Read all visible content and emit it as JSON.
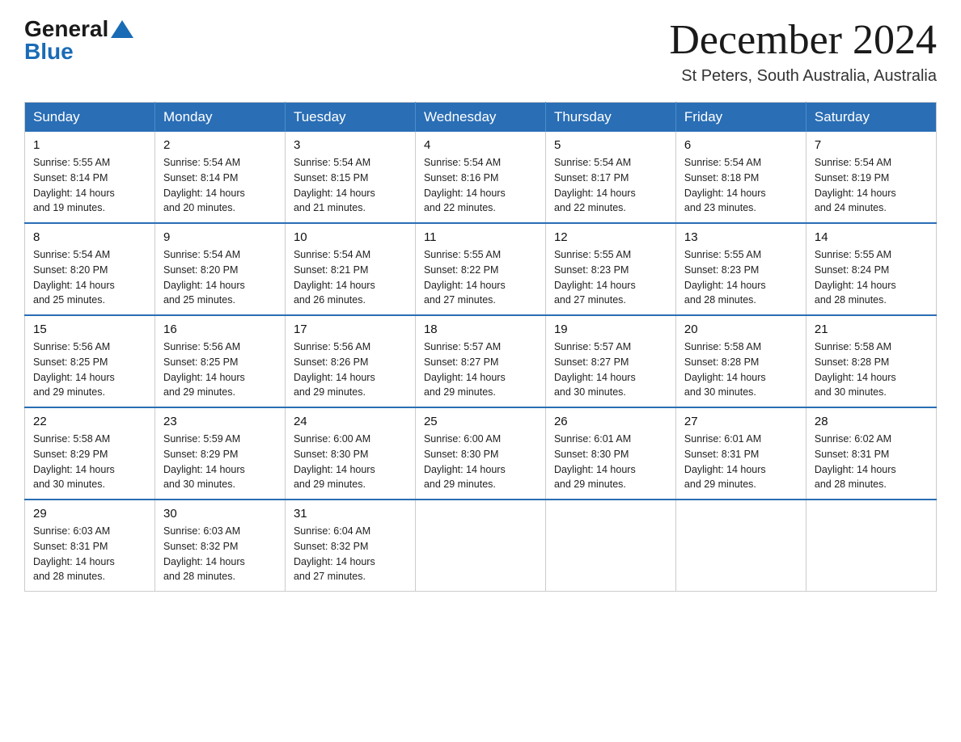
{
  "header": {
    "logo_general": "General",
    "logo_blue": "Blue",
    "month_title": "December 2024",
    "subtitle": "St Peters, South Australia, Australia"
  },
  "days_of_week": [
    "Sunday",
    "Monday",
    "Tuesday",
    "Wednesday",
    "Thursday",
    "Friday",
    "Saturday"
  ],
  "weeks": [
    [
      {
        "day": "1",
        "info": "Sunrise: 5:55 AM\nSunset: 8:14 PM\nDaylight: 14 hours\nand 19 minutes."
      },
      {
        "day": "2",
        "info": "Sunrise: 5:54 AM\nSunset: 8:14 PM\nDaylight: 14 hours\nand 20 minutes."
      },
      {
        "day": "3",
        "info": "Sunrise: 5:54 AM\nSunset: 8:15 PM\nDaylight: 14 hours\nand 21 minutes."
      },
      {
        "day": "4",
        "info": "Sunrise: 5:54 AM\nSunset: 8:16 PM\nDaylight: 14 hours\nand 22 minutes."
      },
      {
        "day": "5",
        "info": "Sunrise: 5:54 AM\nSunset: 8:17 PM\nDaylight: 14 hours\nand 22 minutes."
      },
      {
        "day": "6",
        "info": "Sunrise: 5:54 AM\nSunset: 8:18 PM\nDaylight: 14 hours\nand 23 minutes."
      },
      {
        "day": "7",
        "info": "Sunrise: 5:54 AM\nSunset: 8:19 PM\nDaylight: 14 hours\nand 24 minutes."
      }
    ],
    [
      {
        "day": "8",
        "info": "Sunrise: 5:54 AM\nSunset: 8:20 PM\nDaylight: 14 hours\nand 25 minutes."
      },
      {
        "day": "9",
        "info": "Sunrise: 5:54 AM\nSunset: 8:20 PM\nDaylight: 14 hours\nand 25 minutes."
      },
      {
        "day": "10",
        "info": "Sunrise: 5:54 AM\nSunset: 8:21 PM\nDaylight: 14 hours\nand 26 minutes."
      },
      {
        "day": "11",
        "info": "Sunrise: 5:55 AM\nSunset: 8:22 PM\nDaylight: 14 hours\nand 27 minutes."
      },
      {
        "day": "12",
        "info": "Sunrise: 5:55 AM\nSunset: 8:23 PM\nDaylight: 14 hours\nand 27 minutes."
      },
      {
        "day": "13",
        "info": "Sunrise: 5:55 AM\nSunset: 8:23 PM\nDaylight: 14 hours\nand 28 minutes."
      },
      {
        "day": "14",
        "info": "Sunrise: 5:55 AM\nSunset: 8:24 PM\nDaylight: 14 hours\nand 28 minutes."
      }
    ],
    [
      {
        "day": "15",
        "info": "Sunrise: 5:56 AM\nSunset: 8:25 PM\nDaylight: 14 hours\nand 29 minutes."
      },
      {
        "day": "16",
        "info": "Sunrise: 5:56 AM\nSunset: 8:25 PM\nDaylight: 14 hours\nand 29 minutes."
      },
      {
        "day": "17",
        "info": "Sunrise: 5:56 AM\nSunset: 8:26 PM\nDaylight: 14 hours\nand 29 minutes."
      },
      {
        "day": "18",
        "info": "Sunrise: 5:57 AM\nSunset: 8:27 PM\nDaylight: 14 hours\nand 29 minutes."
      },
      {
        "day": "19",
        "info": "Sunrise: 5:57 AM\nSunset: 8:27 PM\nDaylight: 14 hours\nand 30 minutes."
      },
      {
        "day": "20",
        "info": "Sunrise: 5:58 AM\nSunset: 8:28 PM\nDaylight: 14 hours\nand 30 minutes."
      },
      {
        "day": "21",
        "info": "Sunrise: 5:58 AM\nSunset: 8:28 PM\nDaylight: 14 hours\nand 30 minutes."
      }
    ],
    [
      {
        "day": "22",
        "info": "Sunrise: 5:58 AM\nSunset: 8:29 PM\nDaylight: 14 hours\nand 30 minutes."
      },
      {
        "day": "23",
        "info": "Sunrise: 5:59 AM\nSunset: 8:29 PM\nDaylight: 14 hours\nand 30 minutes."
      },
      {
        "day": "24",
        "info": "Sunrise: 6:00 AM\nSunset: 8:30 PM\nDaylight: 14 hours\nand 29 minutes."
      },
      {
        "day": "25",
        "info": "Sunrise: 6:00 AM\nSunset: 8:30 PM\nDaylight: 14 hours\nand 29 minutes."
      },
      {
        "day": "26",
        "info": "Sunrise: 6:01 AM\nSunset: 8:30 PM\nDaylight: 14 hours\nand 29 minutes."
      },
      {
        "day": "27",
        "info": "Sunrise: 6:01 AM\nSunset: 8:31 PM\nDaylight: 14 hours\nand 29 minutes."
      },
      {
        "day": "28",
        "info": "Sunrise: 6:02 AM\nSunset: 8:31 PM\nDaylight: 14 hours\nand 28 minutes."
      }
    ],
    [
      {
        "day": "29",
        "info": "Sunrise: 6:03 AM\nSunset: 8:31 PM\nDaylight: 14 hours\nand 28 minutes."
      },
      {
        "day": "30",
        "info": "Sunrise: 6:03 AM\nSunset: 8:32 PM\nDaylight: 14 hours\nand 28 minutes."
      },
      {
        "day": "31",
        "info": "Sunrise: 6:04 AM\nSunset: 8:32 PM\nDaylight: 14 hours\nand 27 minutes."
      },
      {
        "day": "",
        "info": ""
      },
      {
        "day": "",
        "info": ""
      },
      {
        "day": "",
        "info": ""
      },
      {
        "day": "",
        "info": ""
      }
    ]
  ]
}
